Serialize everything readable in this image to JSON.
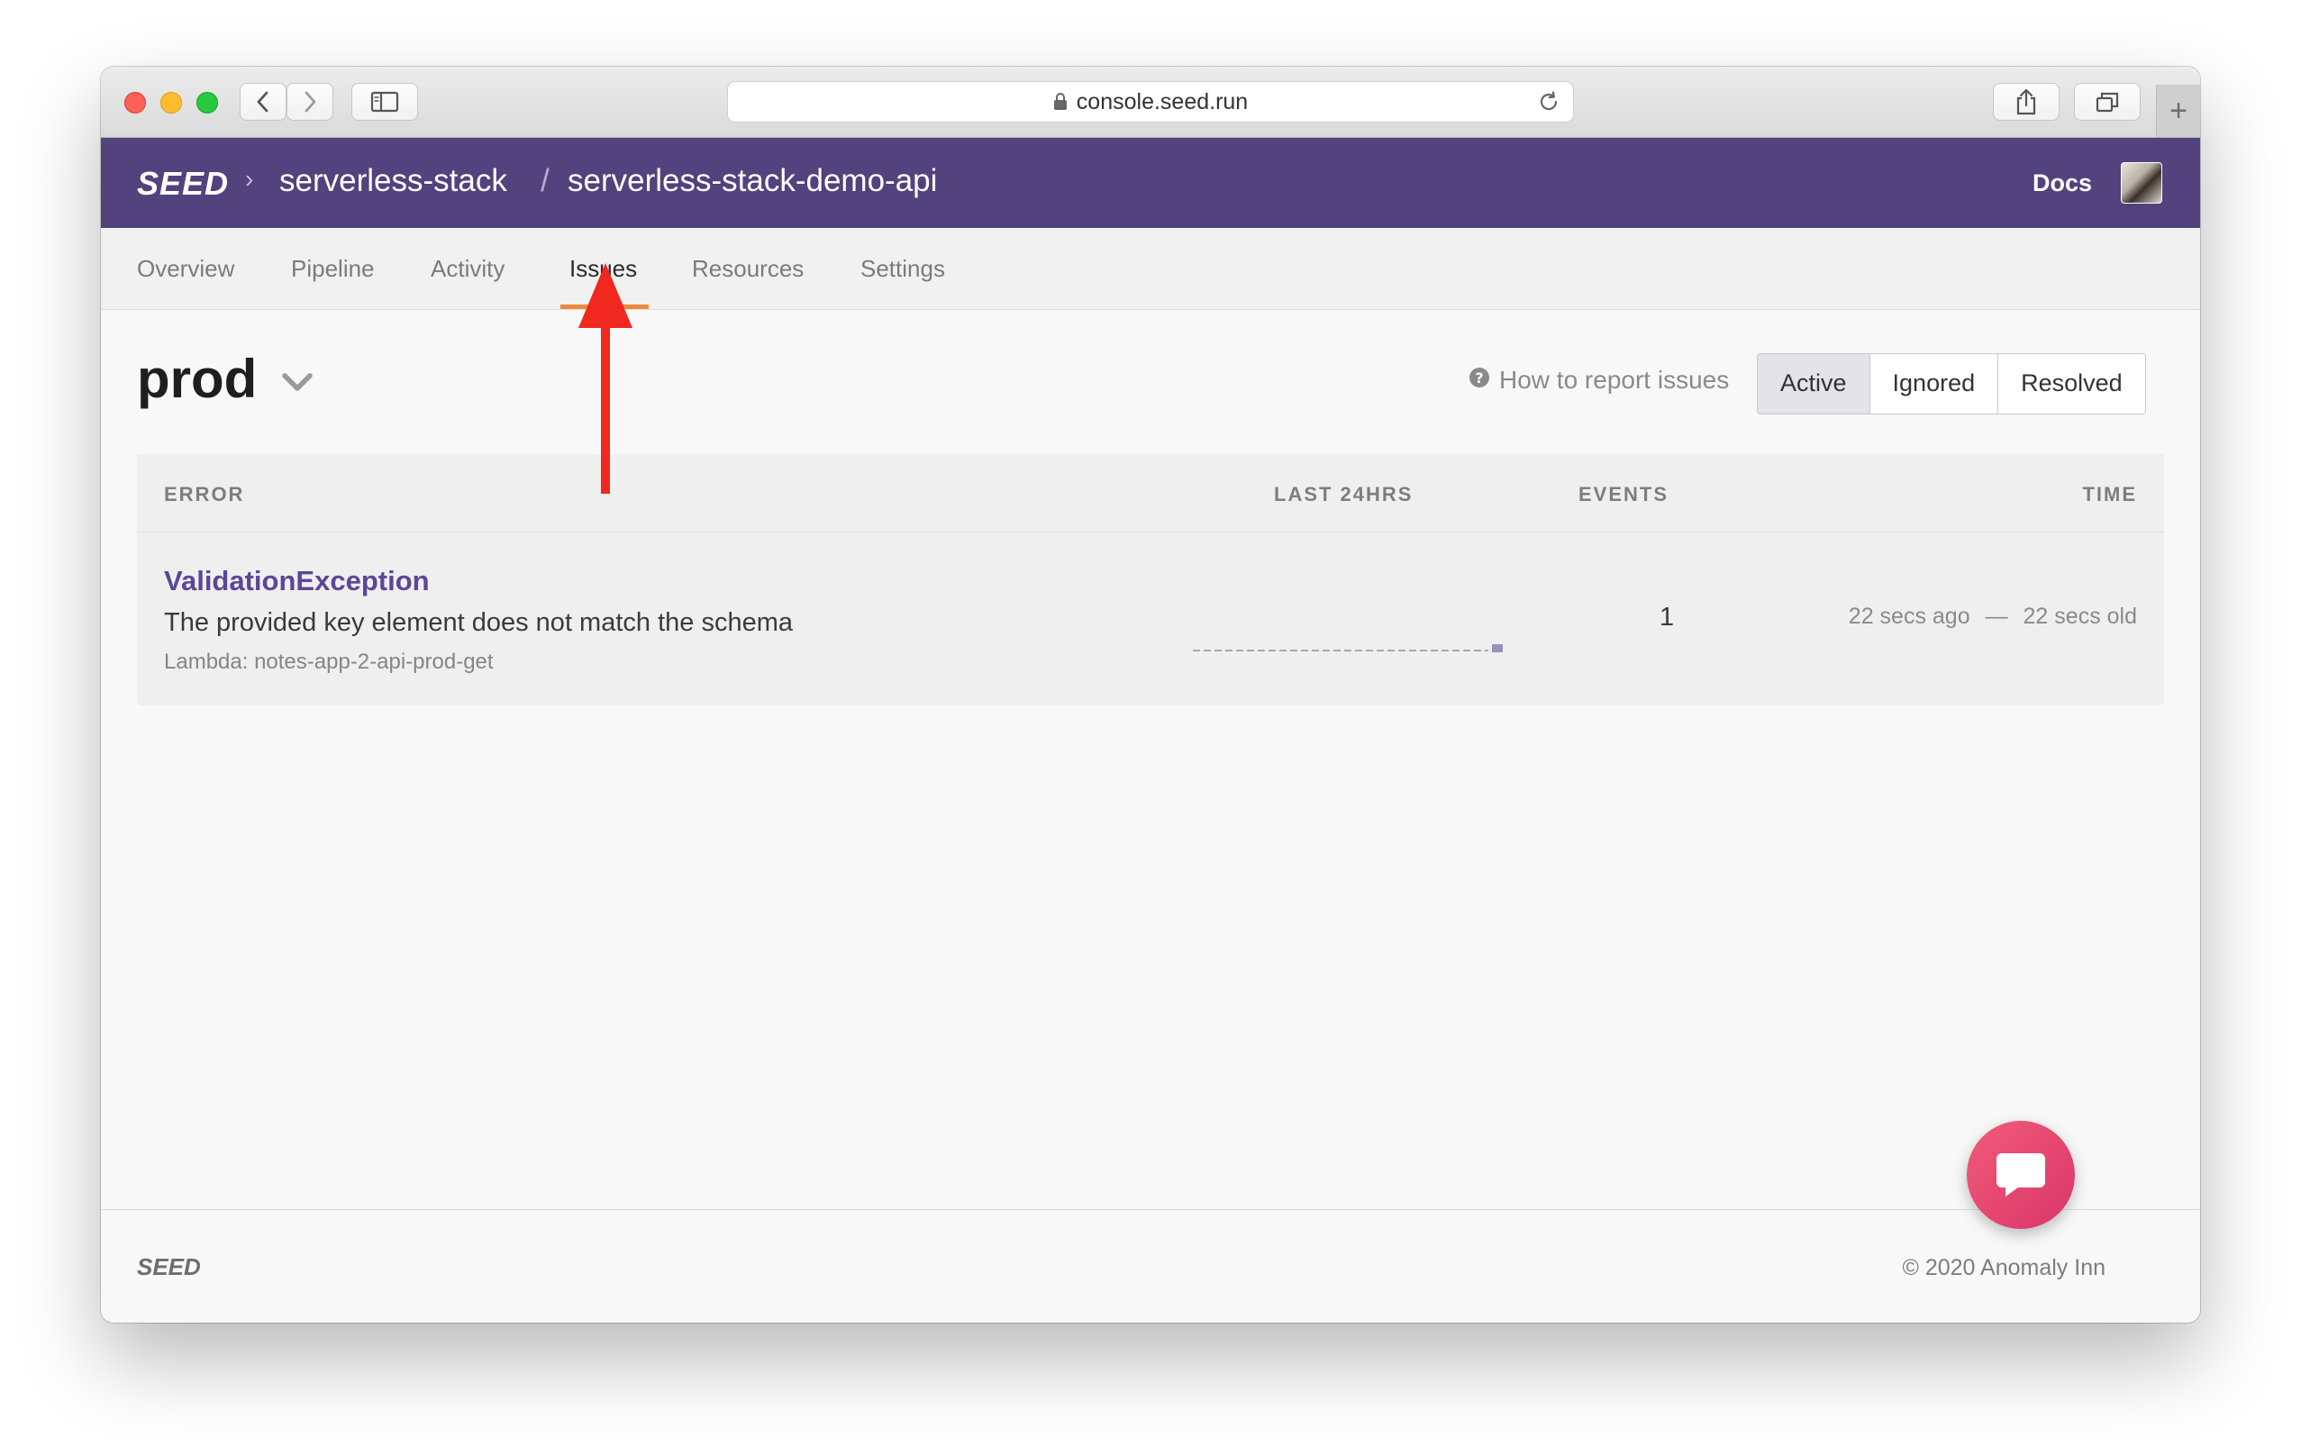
{
  "browser": {
    "url": "console.seed.run",
    "new_tab_symbol": "+"
  },
  "header": {
    "logo": "SEED",
    "breadcrumb_separator": "›",
    "org": "serverless-stack",
    "slash": "/",
    "app": "serverless-stack-demo-api",
    "docs": "Docs"
  },
  "tabs": [
    {
      "label": "Overview"
    },
    {
      "label": "Pipeline"
    },
    {
      "label": "Activity"
    },
    {
      "label": "Issues"
    },
    {
      "label": "Resources"
    },
    {
      "label": "Settings"
    }
  ],
  "active_tab": "Issues",
  "stage": {
    "name": "prod"
  },
  "help_link": "How to report issues",
  "filters": [
    "Active",
    "Ignored",
    "Resolved"
  ],
  "selected_filter": "Active",
  "table": {
    "headers": {
      "error": "ERROR",
      "last24": "LAST 24HRS",
      "events": "EVENTS",
      "time": "TIME"
    },
    "rows": [
      {
        "title": "ValidationException",
        "message": "The provided key element does not match the schema",
        "source": "Lambda: notes-app-2-api-prod-get",
        "events": "1",
        "time_ago": "22 secs ago",
        "time_sep": "—",
        "age": "22 secs old"
      }
    ]
  },
  "footer": {
    "logo": "SEED",
    "copyright": "© 2020 Anomaly Inn"
  },
  "colors": {
    "header_bg": "#52427d",
    "tab_active_underline": "#f0883c",
    "error_title": "#5b4796",
    "annotation_arrow": "#f0281e",
    "chat_bubble": "#e8436f"
  }
}
